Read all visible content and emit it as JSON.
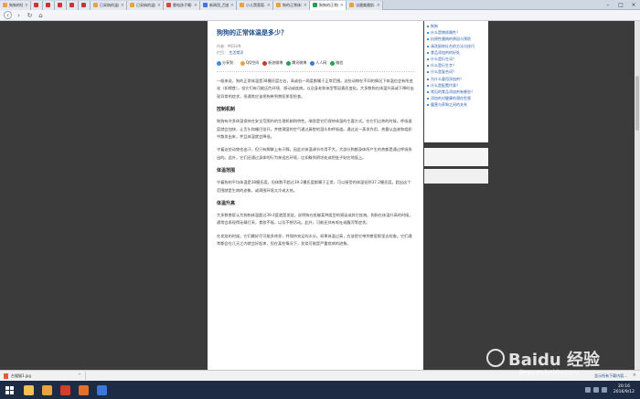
{
  "browser": {
    "tabs": [
      {
        "label": "狗狗的短毛_个…",
        "favicon_color": "#e8a33d",
        "active": false
      },
      {
        "label": "",
        "favicon_color": "#cc3333",
        "active": false
      },
      {
        "label": "",
        "favicon_color": "#cc3333",
        "active": false
      },
      {
        "label": "",
        "favicon_color": "#cc3333",
        "active": false
      },
      {
        "label": "",
        "favicon_color": "#cc3333",
        "active": false
      },
      {
        "label": "",
        "favicon_color": "#cc3333",
        "active": false
      },
      {
        "label": "已采纳的温度…",
        "favicon_color": "#e8a33d",
        "active": false
      },
      {
        "label": "已采纳的温度…",
        "favicon_color": "#e8a33d",
        "active": false
      },
      {
        "label": "雷电孩子睡不…",
        "favicon_color": "#d04e3a",
        "active": false
      },
      {
        "label": "新闻用_百度…",
        "favicon_color": "#3c78d8",
        "active": false
      },
      {
        "label": "小儿黑葡萄…",
        "favicon_color": "#e8a33d",
        "active": false
      },
      {
        "label": "狗的正常体温…",
        "favicon_color": "#e8a33d",
        "active": false
      },
      {
        "label": "狗狗的正常体…",
        "favicon_color": "#2a9d58",
        "active": true
      },
      {
        "label": "法國美國前…",
        "favicon_color": "#e8a33d",
        "active": false
      }
    ],
    "nav": {
      "back": "‹",
      "forward": "›",
      "refresh": "↻",
      "home": "⌂"
    }
  },
  "article": {
    "title": "狗狗的正常体温是多少？",
    "author": "作者：MESUN",
    "column_label": "栏目：",
    "column_value": "生活常识",
    "share": [
      {
        "label": "分享到：",
        "color": "#3a8ee6"
      },
      {
        "label": "QQ空间",
        "color": "#e8a33d"
      },
      {
        "label": "新浪微博",
        "color": "#d0342c"
      },
      {
        "label": "腾讯微博",
        "color": "#2a9d58"
      },
      {
        "label": "人人网",
        "color": "#3c78d8"
      },
      {
        "label": "微信",
        "color": "#2a9d58"
      }
    ],
    "intro": "一般来说，狗的正常体温是38摄氏度左右，高或低一两度都属于正常范围。这些动物在不同的情况下体温也会有所变化（如喂食），但它们有可能因为环境、感动或疾病。以及身老和体型等因素而变化。大多数狗在体温升高或下降时出现异常的症状，但通常应该把狗带到兽医那里检查。",
    "sections": [
      {
        "heading": "控制机制",
        "paragraphs": [
          "狗狗有许多体温保持在安全范围内的生理机制和特性。喘息是它们保持体温的主要方式。在它们过热的时候，呼吸速度就会加快，让舌头和嘴巴张开，并使潮湿的空气通过鼻腔的湿头和呼吸道。通过这一蒸发作用，热量从血液和组织中散发出来，并且体温就会降低。",
          "守着这些动物也出汗，但只有脚掌上有汗腺。因此对体温调节作用不大。大部分狗都身体所产生的热都是通过呼吸排出的。此外，它们还通过身体的行为来适应环境，比如躲到阴凉处或把肚子贴在地面上。"
        ]
      },
      {
        "heading": "体温范围",
        "paragraphs": [
          "守着狗的平均体温是38摄氏度。但体数不超过39.2摄氏度都属于正常，可以接受的体温低到37.2摄氏度。超出这个范围就是生病的迹象，或周围环境太冷或太热。"
        ]
      },
      {
        "heading": "体温升高",
        "paragraphs": [
          "大多数兽医认为狗狗体温超过39.4度就是发烧，说明狗在抵御某种类型的感染或其它疾病。狗狗在体温升高的时候，通常会表现得无精打采，食欲不振，以及不想活动。此外，可能还伴有呕吐或腹泻等症状。",
          "在发烧的时候，它们最好尽可能多休息，并保持充足的水分。如果体温过高，应该把它带到兽医那里去检查。它们通常都会在几天之内就会好起来，但在某些情况下，发烧可能是严重疾病的迹象。"
        ]
      }
    ]
  },
  "sidebar": {
    "items": [
      "狗狗",
      "什么是物质属性？",
      "抗原性膜病的原因与预防",
      "清洗厨房灶台的方法与技巧",
      "食品添加剂的好处",
      "什么是衍生词？",
      "什么是衍生字？",
      "什么是复合词？",
      "为什么要用添加剂？",
      "什么是配置代表？",
      "常见的食品添加剂有哪些？",
      "添加剂对健康的潜在危害",
      "露营与养狗之间的关系"
    ]
  },
  "downloads": {
    "file_name": "台猫猫1.jpg",
    "show_all": "显示所有下载内容...",
    "close": "×"
  },
  "taskbar": {
    "time": "20:16",
    "date": "2016/9/12",
    "icons": [
      {
        "name": "file-explorer",
        "color": "#f2c14e"
      },
      {
        "name": "browser",
        "color": "#e8a33d"
      },
      {
        "name": "app-red",
        "color": "#d93a2b"
      },
      {
        "name": "app-orange",
        "color": "#e76f2c"
      },
      {
        "name": "app-blue",
        "color": "#3c78d8"
      }
    ]
  },
  "watermark": {
    "main": "Baidu 经验",
    "sub": "jingyan.baidu.com"
  }
}
